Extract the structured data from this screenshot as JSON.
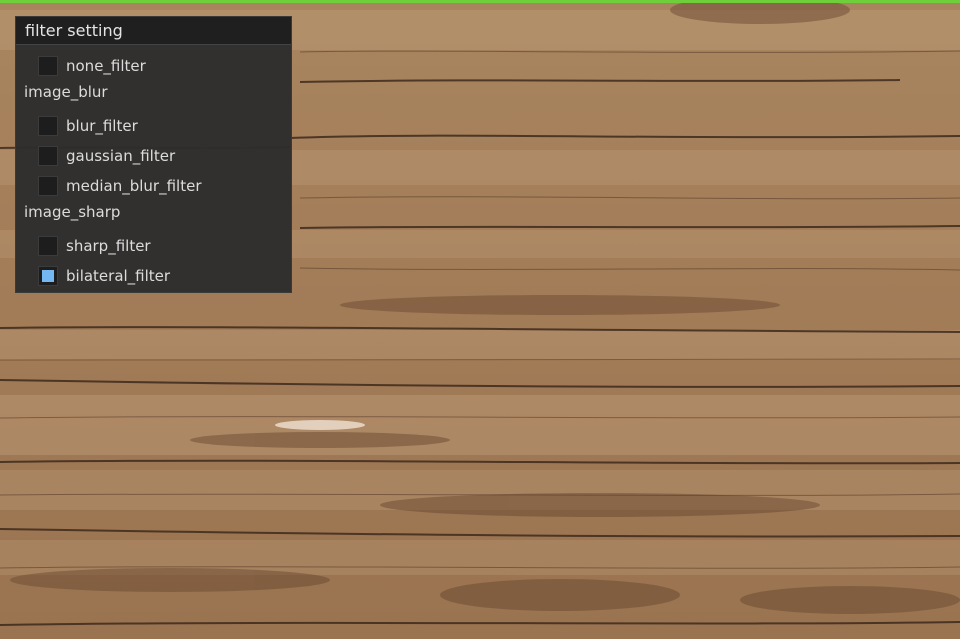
{
  "panel": {
    "title": "filter setting",
    "items": [
      {
        "type": "checkbox",
        "label": "none_filter",
        "checked": false
      },
      {
        "type": "section",
        "label": "image_blur"
      },
      {
        "type": "checkbox",
        "label": "blur_filter",
        "checked": false
      },
      {
        "type": "checkbox",
        "label": "gaussian_filter",
        "checked": false
      },
      {
        "type": "checkbox",
        "label": "median_blur_filter",
        "checked": false
      },
      {
        "type": "section",
        "label": "image_sharp"
      },
      {
        "type": "checkbox",
        "label": "sharp_filter",
        "checked": false
      },
      {
        "type": "checkbox",
        "label": "bilateral_filter",
        "checked": true
      }
    ]
  },
  "colors": {
    "checked_fill": "#73b8f2",
    "top_strip": "#6fcf3a",
    "wood_base": "#a07b58"
  }
}
